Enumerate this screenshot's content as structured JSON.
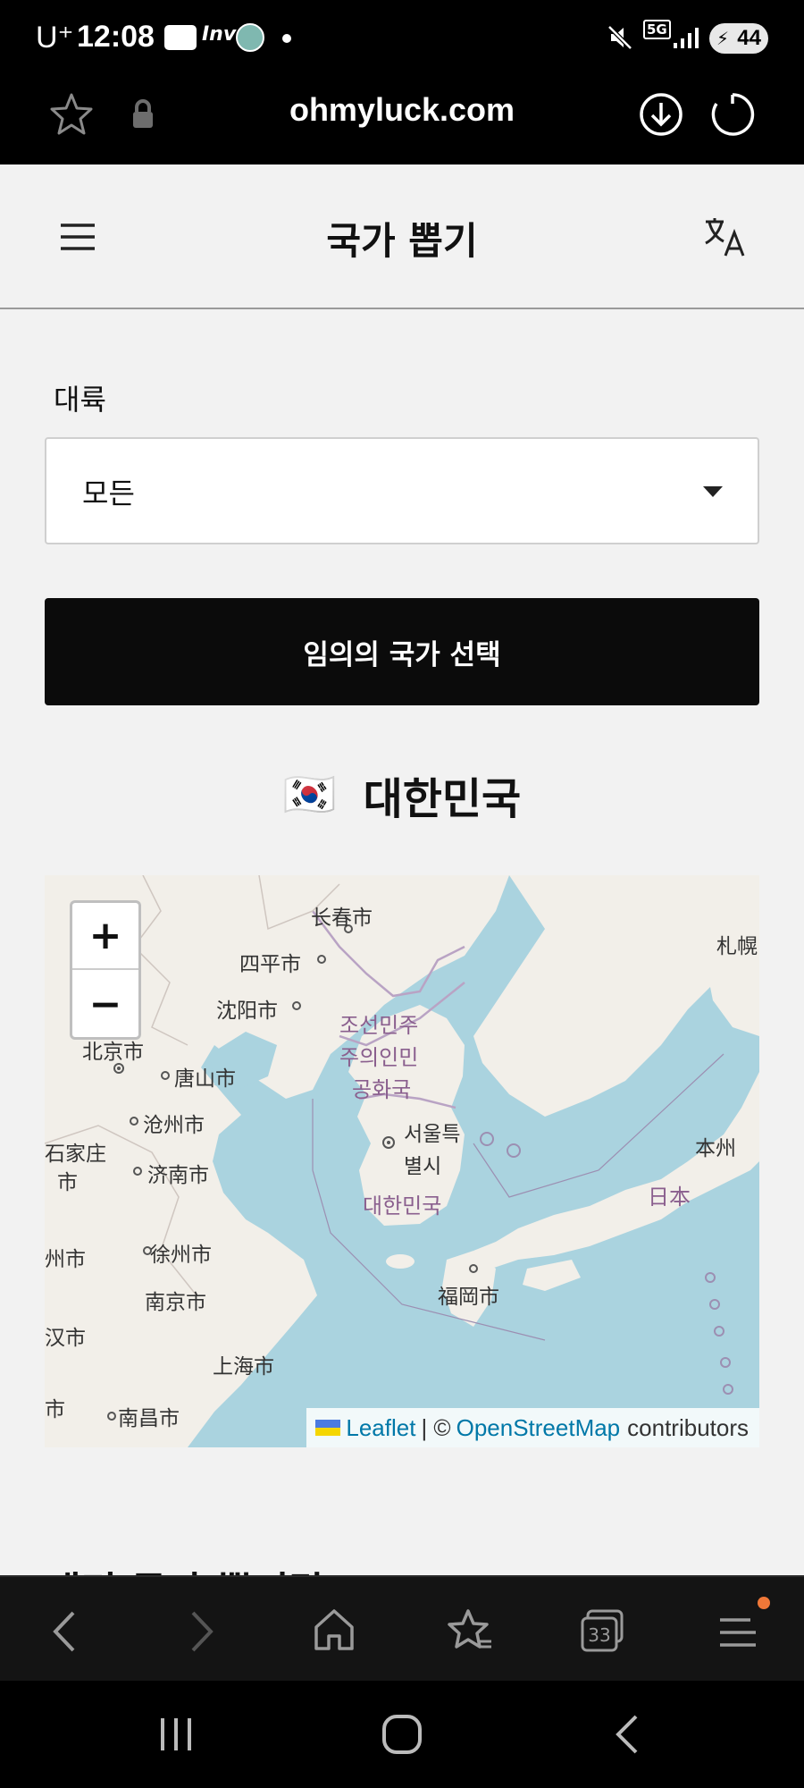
{
  "status_bar": {
    "carrier": "U⁺",
    "time": "12:08",
    "app_icons": [
      "webtoon-icon",
      "inven-icon",
      "app-avatar-icon"
    ],
    "network": "5G",
    "battery": "44"
  },
  "url_bar": {
    "url": "ohmyluck.com"
  },
  "header": {
    "title": "국가 뽑기"
  },
  "form": {
    "continent_label": "대륙",
    "continent_selected": "모든",
    "submit_label": "임의의 국가 선택"
  },
  "result": {
    "flag": "🇰🇷",
    "country": "대한민국"
  },
  "map": {
    "zoom_in": "+",
    "zoom_out": "−",
    "labels": {
      "changchun": "长春市",
      "siping": "四平市",
      "shenyang": "沈阳市",
      "beijing": "北京市",
      "tangshan": "唐山市",
      "cangzhou": "沧州市",
      "shijiazhuang_1": "石家庄",
      "shijiazhuang_2": "市",
      "jinan": "济南市",
      "zhengzhou": "州市",
      "xuzhou": "徐州市",
      "nanjing": "南京市",
      "wuhan": "汉市",
      "shanghai": "上海市",
      "nanchang": "南昌市",
      "changsha": "市",
      "dprk_1": "조선민주",
      "dprk_2": "주의인민",
      "dprk_3": "공화국",
      "seoul_1": "서울특",
      "seoul_2": "별시",
      "rok": "대한민국",
      "fukuoka": "福岡市",
      "japan": "日本",
      "honshu": "本州",
      "sapporo": "札幌"
    },
    "attribution": {
      "leaflet": "Leaflet",
      "separator": "| ©",
      "osm": "OpenStreetMap",
      "suffix": "contributors"
    }
  },
  "next_heading": "재미 국가 뽑기란?"
}
